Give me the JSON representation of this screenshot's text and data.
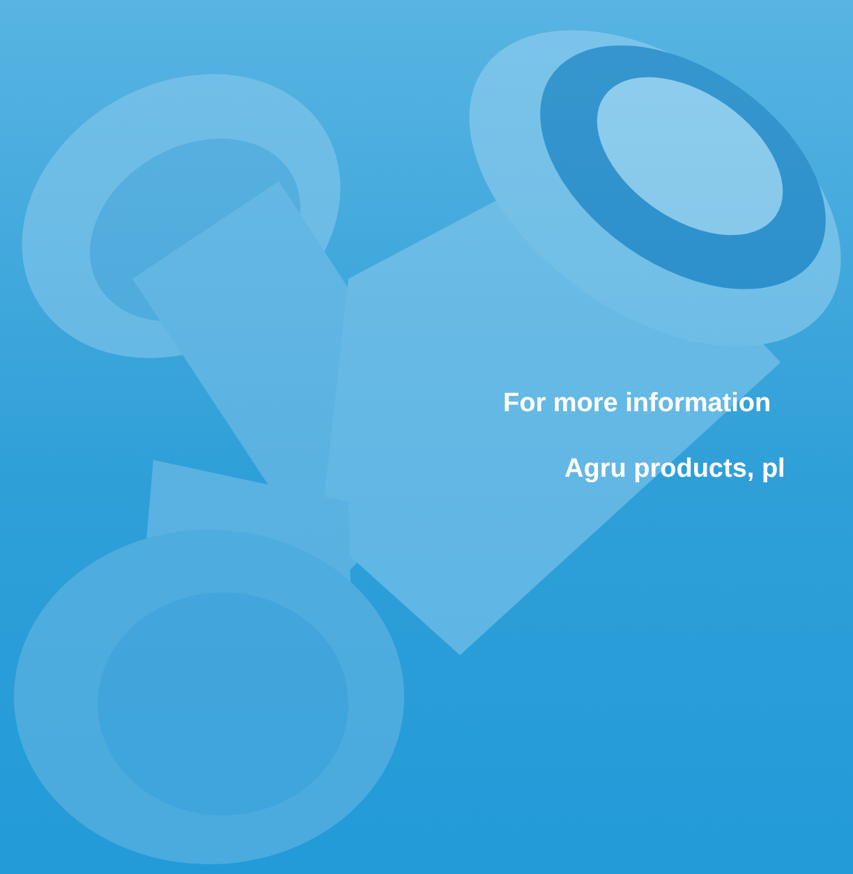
{
  "message": {
    "lines": [
      "For more information",
      "Agru products, pl"
    ]
  }
}
